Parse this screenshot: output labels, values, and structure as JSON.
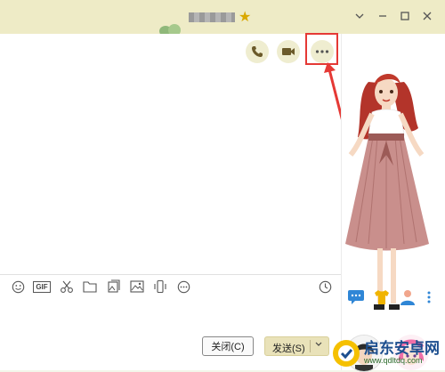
{
  "window": {
    "controls": [
      "chevron-down-icon",
      "minimize-icon",
      "maximize-icon",
      "close-icon"
    ]
  },
  "header_buttons": [
    "phone-icon",
    "video-icon",
    "more-icon"
  ],
  "toolbar": {
    "gif_label": "GIF",
    "icons": [
      "emoji-icon",
      "gif-icon",
      "scissors-icon",
      "folder-icon",
      "image-gallery-icon",
      "image-icon",
      "shake-icon",
      "more-circle-icon",
      "history-clock-icon"
    ]
  },
  "input": {
    "close_label": "关闭(C)",
    "send_label": "发送(S)"
  },
  "watermark": {
    "title": "启东安卓网",
    "url": "www.qdltdq.com"
  },
  "colors": {
    "titlebar": "#eeebc6",
    "highlight": "#e53935",
    "send_button": "#e9e2b9"
  }
}
